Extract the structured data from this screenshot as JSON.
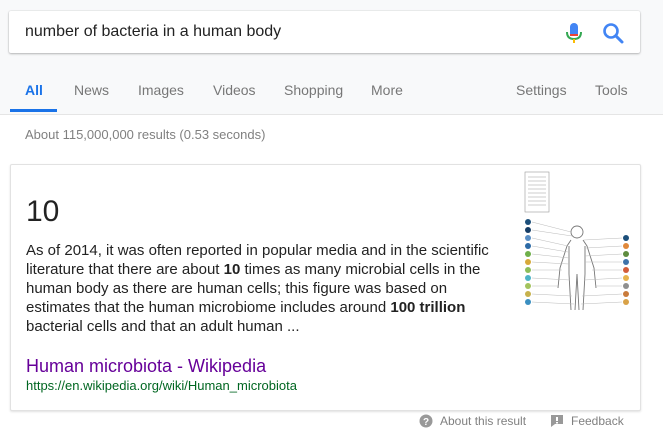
{
  "search": {
    "query": "number of bacteria in a human body",
    "mic_icon": "microphone-icon",
    "search_icon": "magnifier-icon"
  },
  "tabs": [
    {
      "label": "All",
      "active": true
    },
    {
      "label": "News"
    },
    {
      "label": "Images"
    },
    {
      "label": "Videos"
    },
    {
      "label": "Shopping"
    },
    {
      "label": "More"
    },
    {
      "label": "Settings"
    },
    {
      "label": "Tools"
    }
  ],
  "stats": "About 115,000,000 results (0.53 seconds)",
  "featured": {
    "answer": "10",
    "snippet": {
      "t1": "As of 2014, it was often reported in popular media and in the scientific literature that there are about ",
      "b1": "10",
      "t2": " times as many microbial cells in the human body as there are human cells; this figure was based on estimates that the human microbiome includes around ",
      "b2": "100 trillion",
      "t3": " bacterial cells and that an adult human ..."
    },
    "thumbnail_icon": "human-microbiota-diagram",
    "result_title": "Human microbiota - Wikipedia",
    "result_url": "https://en.wikipedia.org/wiki/Human_microbiota"
  },
  "footer": {
    "about": "About this result",
    "feedback": "Feedback"
  },
  "colors": {
    "active_tab": "#1a73e8",
    "visited_link": "#660099",
    "url_green": "#006621",
    "mic_blue": "#4285f4",
    "mic_red": "#ea4335"
  }
}
